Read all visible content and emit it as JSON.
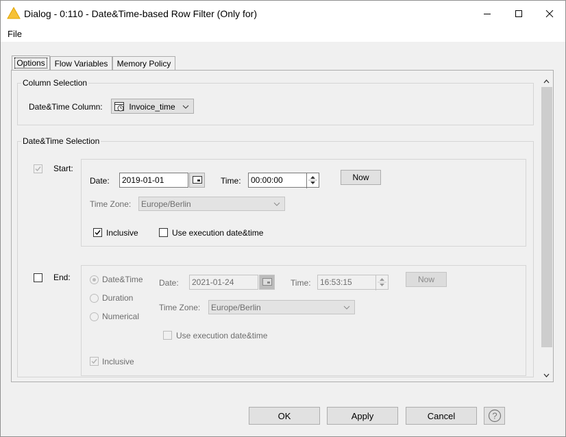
{
  "window": {
    "title": "Dialog - 0:110 - Date&Time-based Row Filter (Only for)",
    "minimize_icon": "minimize-icon",
    "maximize_icon": "maximize-icon",
    "close_icon": "close-icon",
    "app_icon": "warning-triangle-icon"
  },
  "menu": {
    "file": "File"
  },
  "tabs": [
    {
      "label": "Options",
      "active": true
    },
    {
      "label": "Flow Variables",
      "active": false
    },
    {
      "label": "Memory Policy",
      "active": false
    }
  ],
  "column_selection": {
    "group_title": "Column Selection",
    "label": "Date&Time Column:",
    "value": "Invoice_time"
  },
  "datetime_selection": {
    "group_title": "Date&Time Selection",
    "start": {
      "label": "Start:",
      "checked": true,
      "date_label": "Date:",
      "date_value": "2019-01-01",
      "time_label": "Time:",
      "time_value": "00:00:00",
      "now_label": "Now",
      "timezone_label": "Time Zone:",
      "timezone_value": "Europe/Berlin",
      "inclusive_label": "Inclusive",
      "inclusive_checked": true,
      "use_exec_label": "Use execution date&time",
      "use_exec_checked": false
    },
    "end": {
      "label": "End:",
      "checked": false,
      "mode_options": [
        "Date&Time",
        "Duration",
        "Numerical"
      ],
      "mode_selected": "Date&Time",
      "date_label": "Date:",
      "date_value": "2021-01-24",
      "time_label": "Time:",
      "time_value": "16:53:15",
      "now_label": "Now",
      "timezone_label": "Time Zone:",
      "timezone_value": "Europe/Berlin",
      "use_exec_label": "Use execution date&time",
      "use_exec_checked": false,
      "inclusive_label": "Inclusive",
      "inclusive_checked": true
    }
  },
  "buttons": {
    "ok": "OK",
    "apply": "Apply",
    "cancel": "Cancel",
    "help_icon": "help-icon"
  }
}
